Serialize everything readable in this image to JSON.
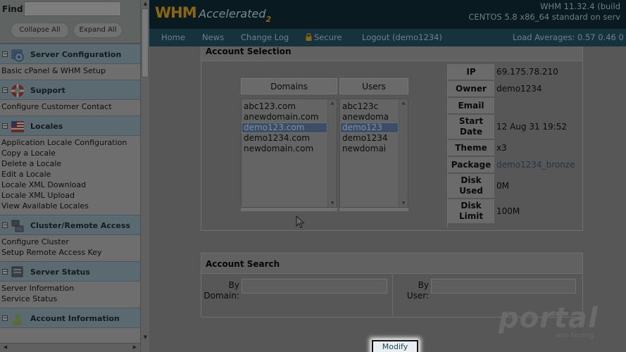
{
  "sidebar": {
    "find_label": "Find",
    "find_value": "",
    "collapse_all": "Collapse All",
    "expand_all": "Expand All",
    "sections": [
      {
        "title": "Server Configuration",
        "icon": "gear-icon",
        "items": [
          "Basic cPanel & WHM Setup"
        ]
      },
      {
        "title": "Support",
        "icon": "lifebuoy-icon",
        "items": [
          "Configure Customer Contact"
        ]
      },
      {
        "title": "Locales",
        "icon": "flag-icon",
        "items": [
          "Application Locale Configuration",
          "Copy a Locale",
          "Delete a Locale",
          "Edit a Locale",
          "Locale XML Download",
          "Locale XML Upload",
          "View Available Locales"
        ]
      },
      {
        "title": "Cluster/Remote Access",
        "icon": "cluster-icon",
        "items": [
          "Configure Cluster",
          "Setup Remote Access Key"
        ]
      },
      {
        "title": "Server Status",
        "icon": "status-icon",
        "items": [
          "Server Information",
          "Service Status"
        ]
      },
      {
        "title": "Account Information",
        "icon": "account-icon",
        "items": []
      }
    ]
  },
  "header": {
    "logo_whm": "WHM",
    "logo_accelerated": "Accelerated",
    "logo_two": "2",
    "version_line1": "WHM 11.32.4 (build",
    "version_line2": "CENTOS 5.8 x86_64 standard on serv"
  },
  "nav": {
    "home": "Home",
    "news": "News",
    "changelog": "Change Log",
    "secure": "Secure",
    "logout": "Logout (demo1234)",
    "load_averages": "Load Averages: 0.57 0.46 0"
  },
  "account_selection": {
    "title": "Account Selection",
    "domains_header": "Domains",
    "users_header": "Users",
    "domains": [
      "abc123.com",
      "anewdomain.com",
      "demo123.com",
      "demo1234.com",
      "newdomain.com"
    ],
    "users": [
      "abc123c",
      "anewdoma",
      "demo123",
      "demo1234",
      "newdomai"
    ],
    "selected_index": 2,
    "info": [
      {
        "key": "IP",
        "value": "69.175.78.210"
      },
      {
        "key": "Owner",
        "value": "demo1234"
      },
      {
        "key": "Email",
        "value": ""
      },
      {
        "key": "Start Date",
        "value": "12 Aug 31 19:52"
      },
      {
        "key": "Theme",
        "value": "x3"
      },
      {
        "key": "Package",
        "value": "demo1234_bronze"
      },
      {
        "key": "Disk Used",
        "value": "0M"
      },
      {
        "key": "Disk Limit",
        "value": "100M"
      }
    ]
  },
  "account_search": {
    "title": "Account Search",
    "by_domain_label": "By Domain:",
    "by_user_label": "By User:",
    "by_domain_value": "",
    "by_user_value": ""
  },
  "modify_button": "Modify",
  "watermark": {
    "main": "portal",
    "sub": "web hosting"
  },
  "colors": {
    "header_bg": "#091a20",
    "nav_bg": "#16333d",
    "logo_gold": "#8a6613",
    "selection": "#3e4d63"
  }
}
